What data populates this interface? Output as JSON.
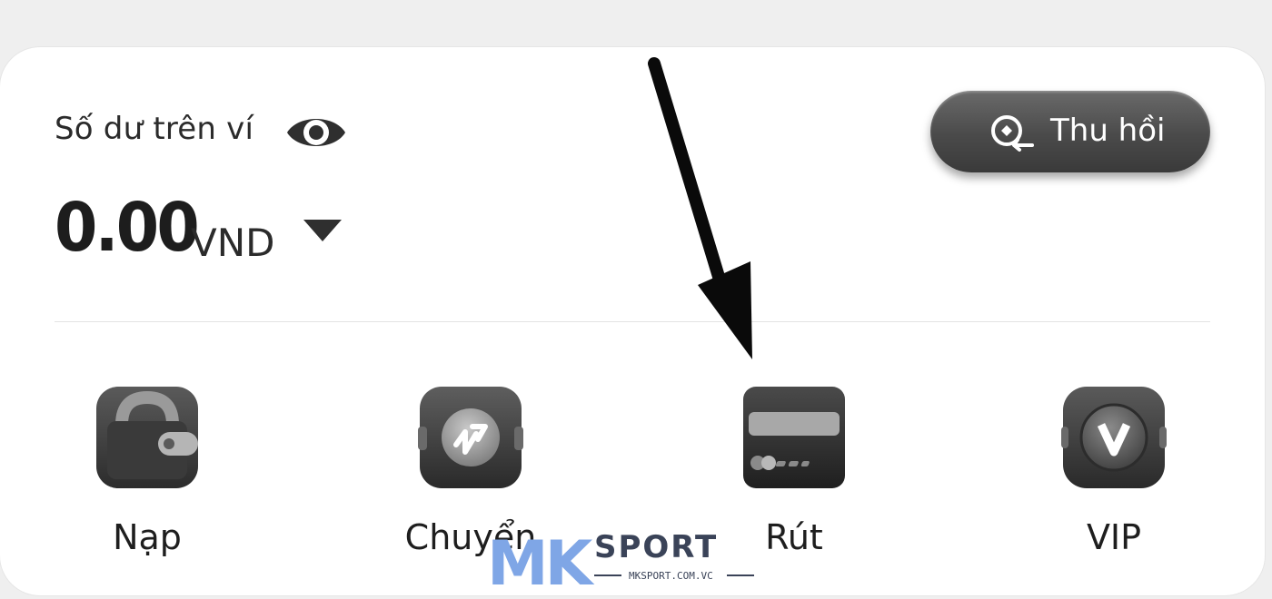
{
  "wallet": {
    "balance_label": "Số dư trên ví",
    "eye_icon": "eye-icon",
    "amount": "0.00",
    "currency": "VND",
    "caret_icon": "caret-down-icon"
  },
  "recall_button": {
    "label": "Thu hồi",
    "icon": "recall-icon"
  },
  "actions": [
    {
      "label": "Nạp",
      "icon": "wallet-icon"
    },
    {
      "label": "Chuyển",
      "icon": "transfer-icon"
    },
    {
      "label": "Rút",
      "icon": "card-icon"
    },
    {
      "label": "VIP",
      "icon": "vip-icon"
    }
  ],
  "watermark": {
    "logo_text": "MK SPORT",
    "url": "MKSPORT.COM.VC"
  },
  "colors": {
    "background": "#efefef",
    "card": "#ffffff",
    "button": "#4a4a4a",
    "text": "#1e1e1e"
  }
}
